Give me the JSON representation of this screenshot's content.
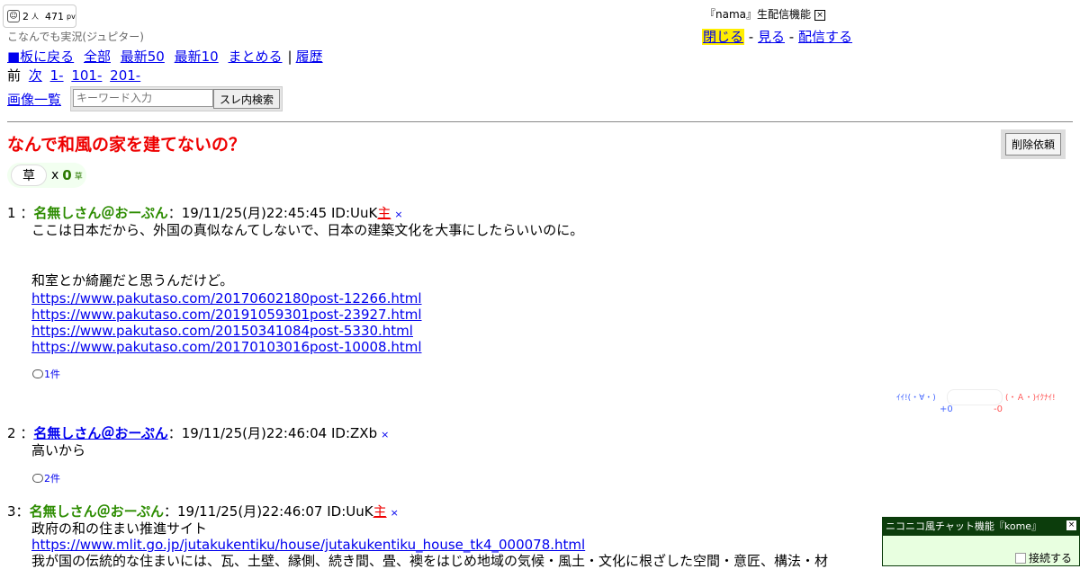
{
  "counter": {
    "people": "2",
    "people_unit": "人",
    "pv": "471",
    "pv_unit": "pv"
  },
  "board_name": "こなんでも実況(ジュピター)",
  "nav": {
    "back_board": "■板に戻る",
    "all": "全部",
    "latest50": "最新50",
    "latest10": "最新10",
    "summarize": "まとめる",
    "separator": "|",
    "history": "履歴",
    "prev": "前",
    "next": "次",
    "page1": "1-",
    "page101": "101-",
    "page201": "201-",
    "images": "画像一覧",
    "search_placeholder": "キーワード入力",
    "search_button": "スレ内検索"
  },
  "nama": {
    "title": "『nama』生配信機能",
    "close_label": "×",
    "hide": "閉じる",
    "dash": "-",
    "watch": "見る",
    "broadcast": "配信する"
  },
  "thread": {
    "title": "なんで和風の家を建てないの？",
    "delete_button": "削除依頼",
    "kusa_label": "草",
    "kusa_x": "x",
    "kusa_count": "0",
    "kusa_unit": "草"
  },
  "posts": [
    {
      "num": "1",
      "sep": "：",
      "name": "名無しさん＠おーぷん",
      "colon": "：",
      "date": "19/11/25(月)22:45:45",
      "id": "ID:UuK",
      "owner": "主",
      "x": "×",
      "lines": [
        "ここは日本だから、外国の真似なんてしないで、日本の建築文化を大事にしたらいいのに。",
        "和室とか綺麗だと思うんだけど。"
      ],
      "links": [
        "https://www.pakutaso.com/20170602180post-12266.html",
        "https://www.pakutaso.com/20191059301post-23927.html",
        "https://www.pakutaso.com/20150341084post-5330.html",
        "https://www.pakutaso.com/20170103016post-10008.html"
      ],
      "replies": "1件"
    },
    {
      "num": "2",
      "sep": "：",
      "name": "名無しさん＠おーぷん",
      "colon": "：",
      "date": "19/11/25(月)22:46:04",
      "id": "ID:ZXb",
      "x": "×",
      "lines": [
        "高いから"
      ],
      "replies": "2件"
    },
    {
      "num": "3",
      "sep": "：",
      "name": "名無しさん＠おーぷん",
      "colon": "：",
      "date": "19/11/25(月)22:46:07",
      "id": "ID:UuK",
      "owner": "主",
      "x": "×",
      "lines": [
        "政府の和の住まい推進サイト",
        "我が国の伝統的な住まいには、瓦、土壁、縁側、続き間、畳、襖をはじめ地域の気候・風土・文化に根ざした空間・意匠、構法・材"
      ],
      "links": [
        "https://www.mlit.go.jp/jutakukentiku/house/jutakukentiku_house_tk4_000078.html"
      ]
    }
  ],
  "vote": {
    "good_label": "ｲｲ!(・∀・)",
    "bad_label": "(・Ａ・)ｲｸﾅｲ!",
    "good_count": "+0",
    "bad_count": "-0"
  },
  "chat": {
    "title": "ニコニコ風チャット機能『kome』",
    "close_label": "×",
    "connect_label": "接続する"
  },
  "colors": {
    "title_red": "#ee0000",
    "name_green": "#2c8c00",
    "link_blue": "#0000ee",
    "highlight_yellow": "#ffee00",
    "chat_bar": "#0c3d0c"
  }
}
